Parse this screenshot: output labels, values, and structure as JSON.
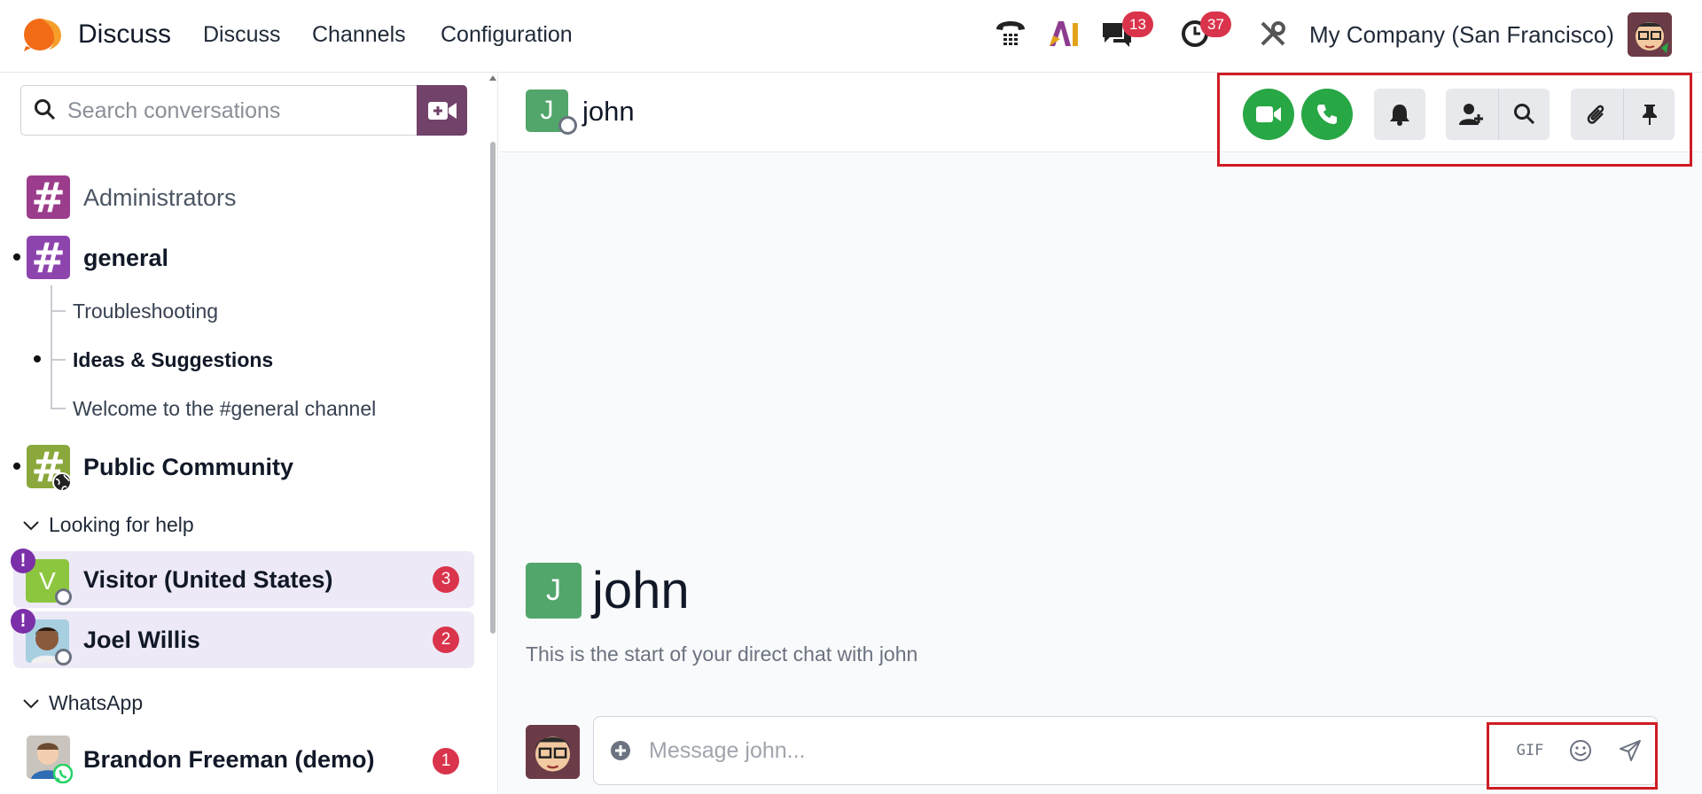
{
  "navbar": {
    "app_name": "Discuss",
    "menus": [
      "Discuss",
      "Channels",
      "Configuration"
    ],
    "messages_badge": "13",
    "activities_badge": "37",
    "company": "My Company (San Francisco)",
    "icons": [
      "phone-icon",
      "ai-icon",
      "messages-icon",
      "activities-clock-icon",
      "tools-icon"
    ]
  },
  "sidebar": {
    "search_placeholder": "Search conversations",
    "channels": [
      {
        "label": "Administrators",
        "color": "#9b3c8c"
      },
      {
        "label": "general",
        "color": "#8e44ad"
      }
    ],
    "sub_channels": [
      "Troubleshooting",
      "Ideas & Suggestions",
      "Welcome to the #general channel"
    ],
    "public_channel": {
      "label": "Public Community",
      "color": "#8aa83b"
    },
    "categories": [
      "Looking for help",
      "WhatsApp"
    ],
    "livechats": [
      {
        "name": "Visitor (United States)",
        "initial": "V",
        "count": "3"
      },
      {
        "name": "Joel Willis",
        "count": "2"
      }
    ],
    "whatsapp": [
      {
        "name": "Brandon Freeman (demo)",
        "count": "1"
      }
    ]
  },
  "thread": {
    "initial": "J",
    "name": "john",
    "intro_text": "This is the start of your direct chat with john",
    "composer_placeholder": "Message john...",
    "gif_label": "GIF"
  },
  "colors": {
    "brand": "#71426a",
    "badge": "#d9344b",
    "call_green": "#28a745",
    "highlight": "#cf1b23"
  }
}
